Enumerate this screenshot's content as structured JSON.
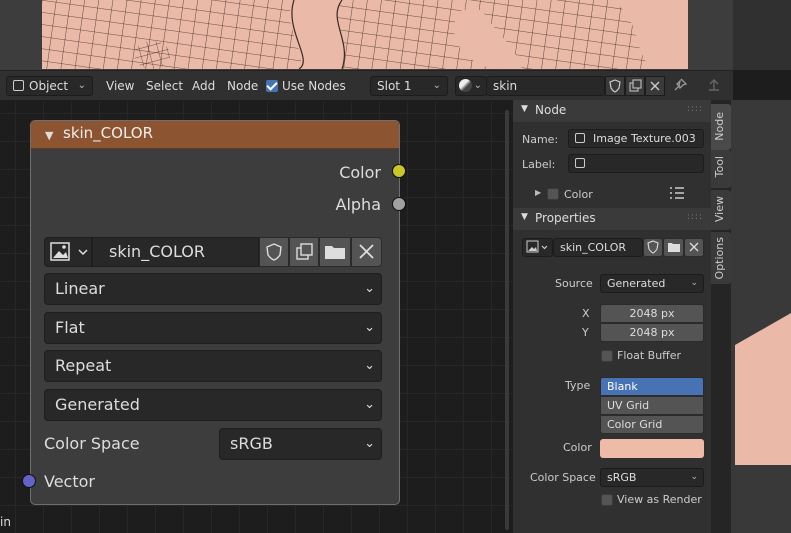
{
  "header": {
    "mode": "Object",
    "menus": [
      "View",
      "Select",
      "Add",
      "Node"
    ],
    "use_nodes_label": "Use Nodes",
    "use_nodes_checked": true,
    "slot": "Slot 1",
    "material": "skin"
  },
  "node": {
    "title": "skin_COLOR",
    "outputs": [
      "Color",
      "Alpha"
    ],
    "image_name": "skin_COLOR",
    "interpolation": "Linear",
    "projection": "Flat",
    "extension": "Repeat",
    "source": "Generated",
    "color_space_label": "Color Space",
    "color_space": "sRGB",
    "input": "Vector",
    "socket_colors": {
      "color": "#c7c729",
      "alpha": "#a1a1a1",
      "vector": "#6363c7"
    }
  },
  "panel": {
    "node_section": "Node",
    "name_label": "Name:",
    "name_value": "Image Texture.003",
    "label_label": "Label:",
    "label_value": "",
    "color_sub": "Color",
    "properties_section": "Properties",
    "image_name": "skin_COLOR",
    "source_label": "Source",
    "source_value": "Generated",
    "x_label": "X",
    "x_value": "2048 px",
    "y_label": "Y",
    "y_value": "2048 px",
    "float_buffer": "Float Buffer",
    "type_label": "Type",
    "type_options": [
      "Blank",
      "UV Grid",
      "Color Grid"
    ],
    "type_selected": "Blank",
    "color_label": "Color",
    "color_value": "#eebba9",
    "color_space_label": "Color Space",
    "color_space_value": "sRGB",
    "view_as_render": "View as Render"
  },
  "tabs": [
    "Node",
    "Tool",
    "View",
    "Options"
  ],
  "corner_text": "in",
  "accent": "#4772b3",
  "node_header_color": "#8c5431"
}
